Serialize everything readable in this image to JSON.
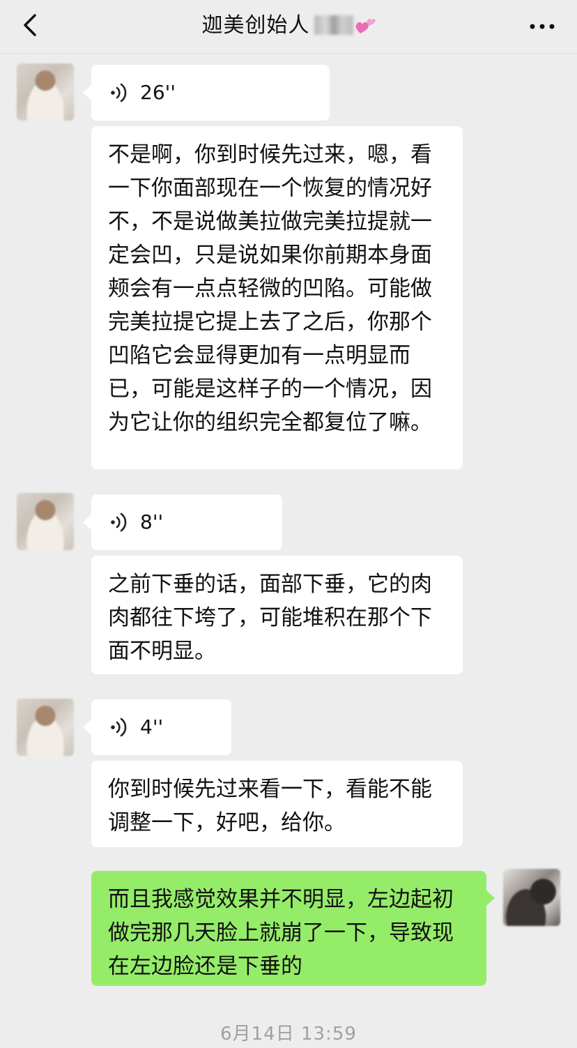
{
  "header": {
    "title": "迦美创始人",
    "back_icon": "chevron-left-icon",
    "more_icon": "more-dots-icon"
  },
  "messages": [
    {
      "type": "voice",
      "sender": "contact",
      "duration": "26''"
    },
    {
      "type": "text",
      "sender": "contact",
      "text": "不是啊，你到时候先过来，嗯，看一下你面部现在一个恢复的情况好不，不是说做美拉做完美拉提就一定会凹，只是说如果你前期本身面颊会有一点点轻微的凹陷。可能做完美拉提它提上去了之后，你那个凹陷它会显得更加有一点明显而已，可能是这样子的一个情况，因为它让你的组织完全都复位了嘛。"
    },
    {
      "type": "voice",
      "sender": "contact",
      "duration": "8''"
    },
    {
      "type": "text",
      "sender": "contact",
      "text": "之前下垂的话，面部下垂，它的肉肉都往下垮了，可能堆积在那个下面不明显。"
    },
    {
      "type": "voice",
      "sender": "contact",
      "duration": "4''"
    },
    {
      "type": "text",
      "sender": "contact",
      "text": "你到时候先过来看一下，看能不能调整一下，好吧，给你。"
    },
    {
      "type": "text",
      "sender": "me",
      "text": "而且我感觉效果并不明显，左边起初做完那几天脸上就崩了一下，导致现在左边脸还是下垂的"
    }
  ],
  "timestamp": "6月14日 13:59",
  "colors": {
    "background": "#ededed",
    "incoming_bubble": "#ffffff",
    "outgoing_bubble": "#95ec69",
    "timestamp": "#a0a0a0"
  }
}
